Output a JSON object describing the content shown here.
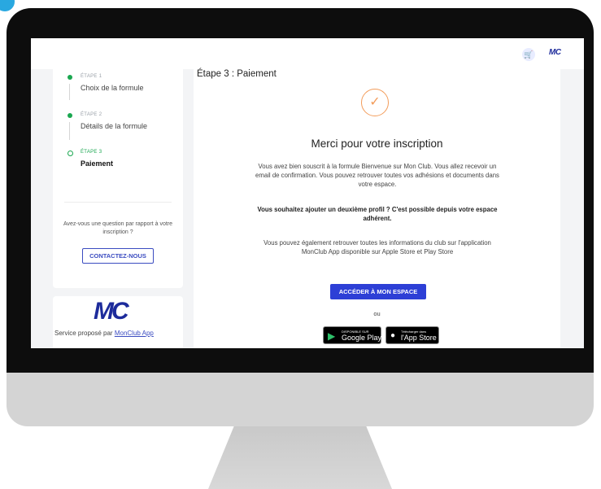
{
  "colors": {
    "accent": "#2d3fd6",
    "brand": "#1d2b9b",
    "success": "#1aa750",
    "check": "#f39c5a"
  },
  "header": {
    "cart_icon": "cart-icon",
    "logo": "MC"
  },
  "steps": [
    {
      "kicker": "ÉTAPE 1",
      "title": "Choix de la formule",
      "status": "done"
    },
    {
      "kicker": "ÉTAPE 2",
      "title": "Détails de la formule",
      "status": "done"
    },
    {
      "kicker": "ÉTAPE 3",
      "title": "Paiement",
      "status": "current"
    }
  ],
  "sidebar": {
    "question": "Avez-vous une question par rapport à votre inscription ?",
    "contact_label": "CONTACTEZ-NOUS",
    "service_logo": "MC",
    "service_prefix": "Service proposé par ",
    "service_link": "MonClub App"
  },
  "main": {
    "title": "Étape 3 : Paiement",
    "check_icon": "check-icon",
    "thanks": "Merci pour votre inscription",
    "para1": "Vous avez bien souscrit à la formule Bienvenue sur Mon Club. Vous allez recevoir un email de confirmation. Vous pouvez retrouver toutes vos adhésions et documents dans votre espace.",
    "para2": "Vous souhaitez ajouter un deuxième profil ? C'est possible depuis votre espace adhérent.",
    "para3": "Vous pouvez également retrouver toutes les informations du club sur l'application MonClub App disponible sur Apple Store et Play Store",
    "space_button": "ACCÉDER À MON ESPACE",
    "or": "ou",
    "google_small": "DISPONIBLE SUR",
    "google_big": "Google Play",
    "apple_small": "Télécharger dans",
    "apple_big": "l'App Store"
  }
}
